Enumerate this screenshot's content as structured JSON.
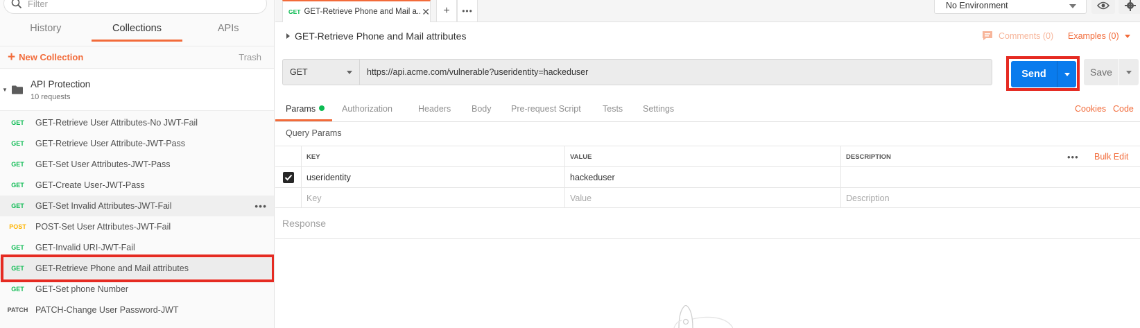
{
  "sidebar": {
    "filter_placeholder": "Filter",
    "tabs": [
      {
        "label": "History"
      },
      {
        "label": "Collections"
      },
      {
        "label": "APIs"
      }
    ],
    "new_collection": "New Collection",
    "trash": "Trash",
    "collection": {
      "name": "API Protection",
      "count": "10 requests"
    },
    "requests": [
      {
        "method": "GET",
        "name": "GET-Retrieve User Attributes-No JWT-Fail"
      },
      {
        "method": "GET",
        "name": "GET-Retrieve User Attribute-JWT-Pass"
      },
      {
        "method": "GET",
        "name": "GET-Set User Attributes-JWT-Pass"
      },
      {
        "method": "GET",
        "name": "GET-Create User-JWT-Pass"
      },
      {
        "method": "GET",
        "name": "GET-Set Invalid Attributes-JWT-Fail"
      },
      {
        "method": "POST",
        "name": "POST-Set User Attributes-JWT-Fail"
      },
      {
        "method": "GET",
        "name": "GET-Invalid URI-JWT-Fail"
      },
      {
        "method": "GET",
        "name": "GET-Retrieve Phone and Mail attributes"
      },
      {
        "method": "GET",
        "name": "GET-Set phone Number"
      },
      {
        "method": "PATCH",
        "name": "PATCH-Change User Password-JWT"
      }
    ]
  },
  "tab": {
    "method": "GET",
    "name": "GET-Retrieve Phone and Mail a..."
  },
  "environment": "No Environment",
  "request": {
    "title": "GET-Retrieve Phone and Mail attributes",
    "comments": "Comments (0)",
    "examples": "Examples (0)",
    "method": "GET",
    "url": "https://api.acme.com/vulnerable?useridentity=hackeduser",
    "send": "Send",
    "save": "Save"
  },
  "subtabs": [
    {
      "label": "Params"
    },
    {
      "label": "Authorization"
    },
    {
      "label": "Headers"
    },
    {
      "label": "Body"
    },
    {
      "label": "Pre-request Script"
    },
    {
      "label": "Tests"
    },
    {
      "label": "Settings"
    }
  ],
  "links": {
    "cookies": "Cookies",
    "code": "Code"
  },
  "query_params": {
    "label": "Query Params",
    "headers": {
      "key": "KEY",
      "value": "VALUE",
      "description": "DESCRIPTION"
    },
    "bulk_edit": "Bulk Edit",
    "rows": [
      {
        "key": "useridentity",
        "value": "hackeduser",
        "description": "",
        "checked": true
      }
    ],
    "placeholders": {
      "key": "Key",
      "value": "Value",
      "description": "Description"
    }
  },
  "response_label": "Response",
  "colors": {
    "accent": "#f26b3a",
    "send": "#097bed",
    "highlight": "#e52b22",
    "get": "#0cbb52",
    "post": "#ffb400"
  }
}
